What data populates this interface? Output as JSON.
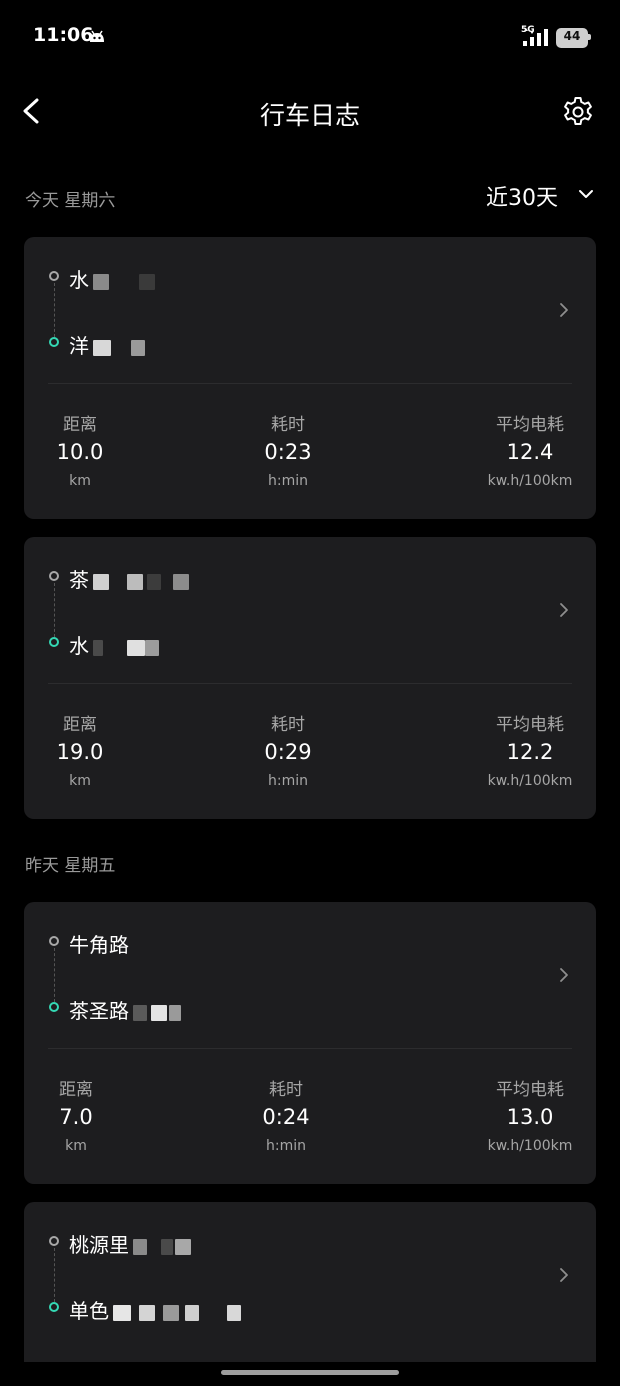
{
  "status_bar": {
    "time": "11:06",
    "network": "5G",
    "battery": "44"
  },
  "header": {
    "title": "行车日志"
  },
  "filter": {
    "range": "近30天"
  },
  "sections": [
    {
      "label": "今天 星期六",
      "trips": [
        {
          "start": "水",
          "end": "洋",
          "distance": "10.0",
          "duration": "0:23",
          "consumption": "12.4"
        },
        {
          "start": "茶",
          "end": "水",
          "distance": "19.0",
          "duration": "0:29",
          "consumption": "12.2"
        }
      ]
    },
    {
      "label": "昨天 星期五",
      "trips": [
        {
          "start": "牛角路",
          "end": "茶圣路",
          "distance": "7.0",
          "duration": "0:24",
          "consumption": "13.0"
        },
        {
          "start": "桃源里",
          "end": "单色"
        }
      ]
    }
  ],
  "metrics": {
    "distance_label": "距离",
    "distance_unit": "km",
    "duration_label": "耗时",
    "duration_unit": "h:min",
    "consumption_label": "平均电耗",
    "consumption_unit": "kw.h/100km"
  }
}
